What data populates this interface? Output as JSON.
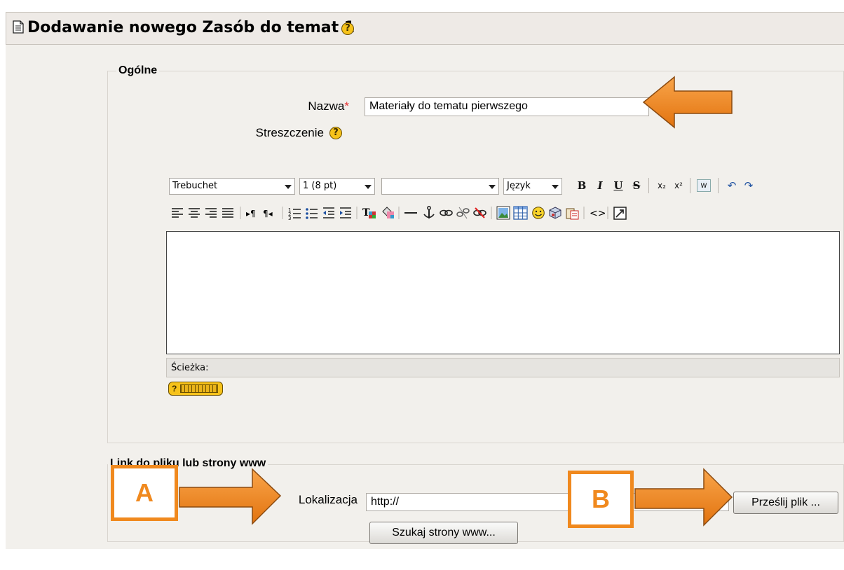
{
  "header": {
    "title": "Dodawanie nowego Zasób do temat 1",
    "doc_icon": "document-icon",
    "help_icon": "help-icon",
    "help_glyph": "?"
  },
  "general": {
    "legend": "Ogólne",
    "name_label": "Nazwa",
    "required_mark": "*",
    "name_value": "Materiały do tematu pierwszego",
    "summary_label": "Streszczenie"
  },
  "editor": {
    "font_select": "Trebuchet",
    "size_select": "1 (8 pt)",
    "style_select": "",
    "language_select": "Język",
    "path_label": "Ścieżka:",
    "row1_buttons": [
      "B",
      "I",
      "U",
      "S",
      "x₂",
      "x²",
      "W",
      "↶",
      "↷"
    ],
    "row2_buttons": [
      "align-left-icon",
      "align-center-icon",
      "align-right-icon",
      "justify-icon",
      "ltr-icon",
      "rtl-icon",
      "numbered-list-icon",
      "bullet-list-icon",
      "outdent-icon",
      "indent-icon",
      "text-color-icon",
      "background-color-icon",
      "horizontal-rule-icon",
      "anchor-icon",
      "link-icon",
      "unlink-icon",
      "no-link-icon",
      "image-icon",
      "table-icon",
      "smiley-icon",
      "special-char-icon",
      "paste-icon",
      "html-source-icon",
      "fullscreen-icon"
    ]
  },
  "link_section": {
    "legend": "Link do pliku lub strony www",
    "location_label": "Lokalizacja",
    "location_value": "http://",
    "upload_button": "Prześlij plik ...",
    "search_button": "Szukaj strony www..."
  },
  "annotations": {
    "a_label": "A",
    "b_label": "B",
    "accent_color": "#f0891e"
  }
}
